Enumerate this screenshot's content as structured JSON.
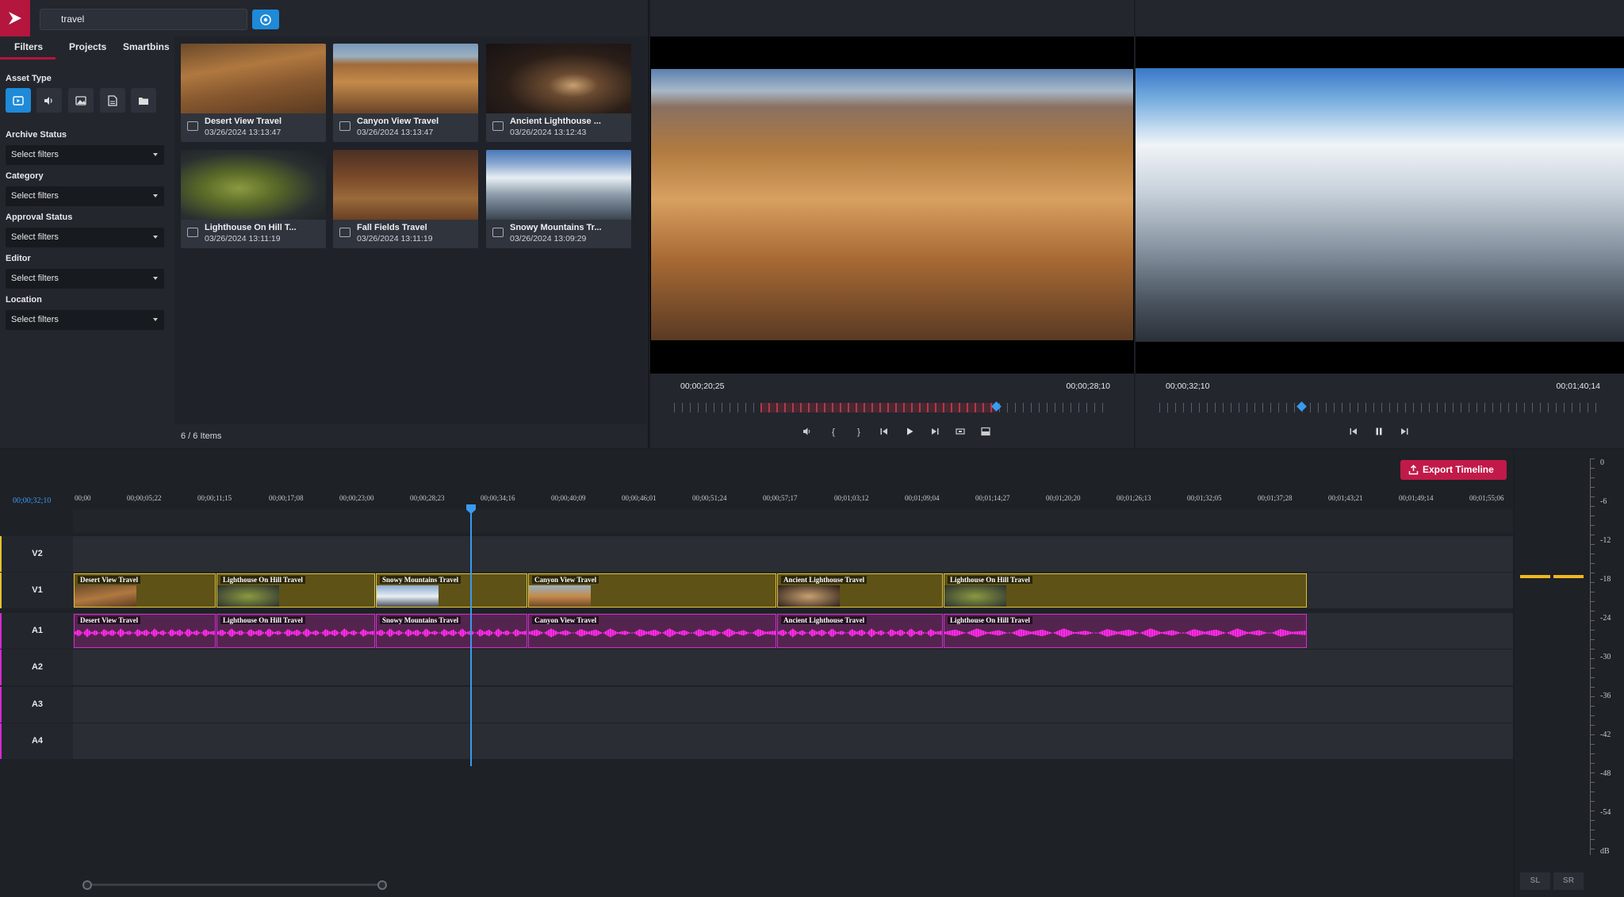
{
  "search": {
    "value": "travel"
  },
  "tabs": [
    "Filters",
    "Projects",
    "Smartbins"
  ],
  "filters": {
    "asset_type_label": "Asset Type",
    "groups": [
      {
        "label": "Archive Status",
        "placeholder": "Select filters"
      },
      {
        "label": "Category",
        "placeholder": "Select filters"
      },
      {
        "label": "Approval Status",
        "placeholder": "Select filters"
      },
      {
        "label": "Editor",
        "placeholder": "Select filters"
      },
      {
        "label": "Location",
        "placeholder": "Select filters"
      }
    ]
  },
  "assets": [
    {
      "title": "Desert View Travel",
      "date": "03/26/2024 13:13:47",
      "thumb": "desert"
    },
    {
      "title": "Canyon View Travel",
      "date": "03/26/2024 13:13:47",
      "thumb": "canyon"
    },
    {
      "title": "Ancient Lighthouse ...",
      "date": "03/26/2024 13:12:43",
      "thumb": "lighthouse"
    },
    {
      "title": "Lighthouse On Hill T...",
      "date": "03/26/2024 13:11:19",
      "thumb": "hill"
    },
    {
      "title": "Fall Fields Travel",
      "date": "03/26/2024 13:11:19",
      "thumb": "fields"
    },
    {
      "title": "Snowy Mountains Tr...",
      "date": "03/26/2024 13:09:29",
      "thumb": "snow"
    }
  ],
  "item_count": "6 / 6 Items",
  "source_viewer": {
    "tc_in": "00;00;20;25",
    "tc_out": "00;00;28;10"
  },
  "program_viewer": {
    "tc_in": "00;00;32;10",
    "tc_out": "00;01;40;14"
  },
  "timeline": {
    "playhead_tc": "00;00;32;10",
    "export_label": "Export Timeline",
    "ruler": [
      "00;00",
      "00;00;05;22",
      "00;00;11;15",
      "00;00;17;08",
      "00;00;23;00",
      "00;00;28;23",
      "00;00;34;16",
      "00;00;40;09",
      "00;00;46;01",
      "00;00;51;24",
      "00;00;57;17",
      "00;01;03;12",
      "00;01;09;04",
      "00;01;14;27",
      "00;01;20;20",
      "00;01;26;13",
      "00;01;32;05",
      "00;01;37;28",
      "00;01;43;21",
      "00;01;49;14",
      "00;01;55;06"
    ],
    "tracks": [
      "V2",
      "V1",
      "A1",
      "A2",
      "A3",
      "A4"
    ],
    "clips": [
      "Desert View Travel",
      "Lighthouse On Hill Travel",
      "Snowy Mountains Travel",
      "Canyon View Travel",
      "Ancient Lighthouse Travel",
      "Lighthouse On Hill Travel"
    ]
  },
  "meter": {
    "scale": [
      "0",
      "-6",
      "-12",
      "-18",
      "-24",
      "-30",
      "-36",
      "-42",
      "-48",
      "-54",
      "dB"
    ],
    "channels": [
      "SL",
      "SR"
    ]
  }
}
